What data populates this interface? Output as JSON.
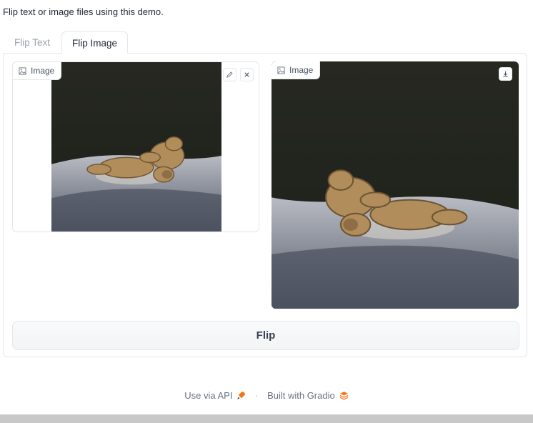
{
  "description": "Flip text or image files using this demo.",
  "tabs": [
    {
      "label": "Flip Text",
      "active": false
    },
    {
      "label": "Flip Image",
      "active": true
    }
  ],
  "input_image": {
    "label": "Image",
    "icon": "image-icon",
    "tools": [
      "edit-icon",
      "close-icon"
    ]
  },
  "output_image": {
    "label": "Image",
    "icon": "image-icon",
    "tools": [
      "download-icon"
    ]
  },
  "flip_button": {
    "label": "Flip"
  },
  "footer": {
    "api_label": "Use via API",
    "separator": "·",
    "built_label": "Built with Gradio"
  },
  "colors": {
    "accent": "#f97316",
    "border": "#e5e7eb",
    "text": "#374151"
  }
}
